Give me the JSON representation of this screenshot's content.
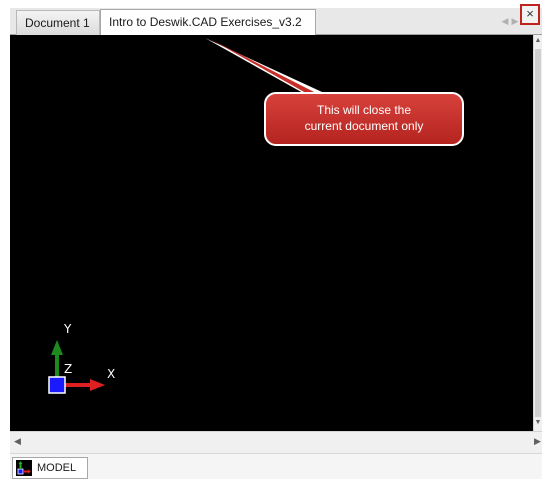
{
  "tabs": [
    {
      "label": "Document 1",
      "active": false
    },
    {
      "label": "Intro to Deswik.CAD Exercises_v3.2",
      "active": true
    }
  ],
  "tab_nav": {
    "left_icon": "chevron-left-icon",
    "right_icon": "chevron-right-icon",
    "close_icon": "close-icon",
    "close_symbol": "×"
  },
  "callout": {
    "line1": "This will close the",
    "line2": "current document only",
    "color": "#c62e29"
  },
  "axes": {
    "y_label": "Y",
    "x_label": "X",
    "z_label": "Z",
    "y_color": "#1e8a1e",
    "x_color": "#e02020",
    "z_color": "#1a1aff"
  },
  "statusbar": {
    "model_tab_label": "MODEL"
  },
  "colors": {
    "viewport_bg": "#000000",
    "highlight_border": "#c0221e"
  }
}
